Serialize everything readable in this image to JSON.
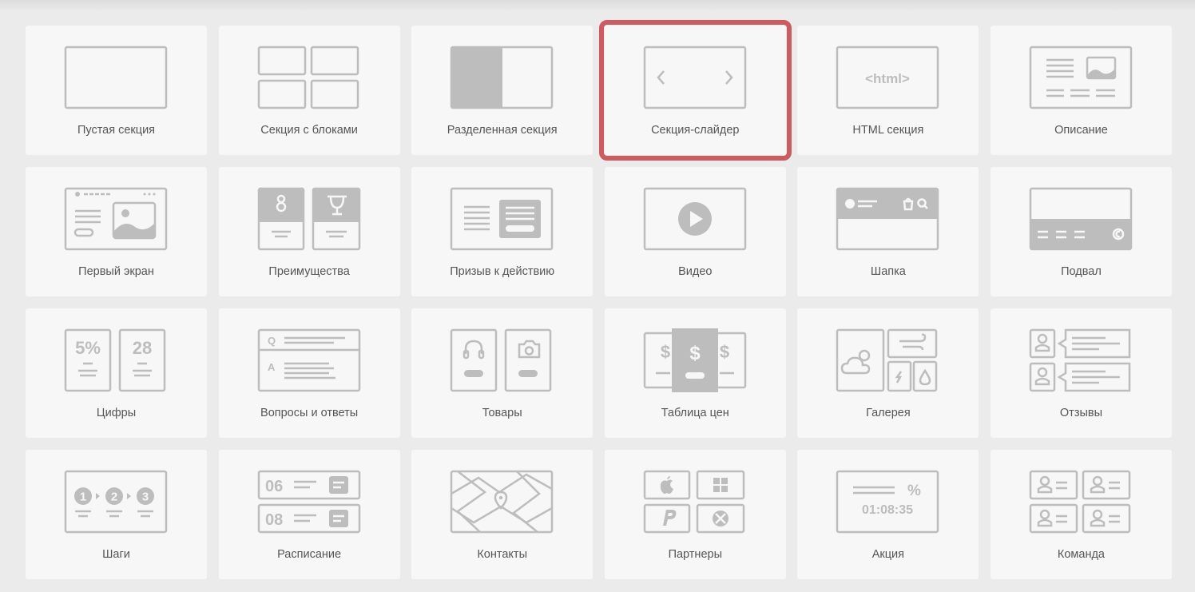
{
  "sections": [
    {
      "label": "Пустая секция",
      "icon": "empty-section-icon",
      "selected": false
    },
    {
      "label": "Секция с блоками",
      "icon": "blocks-section-icon",
      "selected": false
    },
    {
      "label": "Разделенная секция",
      "icon": "split-section-icon",
      "selected": false
    },
    {
      "label": "Секция-слайдер",
      "icon": "slider-section-icon",
      "selected": true
    },
    {
      "label": "HTML секция",
      "icon": "html-section-icon",
      "icon_text": "<html>",
      "selected": false
    },
    {
      "label": "Описание",
      "icon": "description-icon",
      "selected": false
    },
    {
      "label": "Первый экран",
      "icon": "first-screen-icon",
      "selected": false
    },
    {
      "label": "Преимущества",
      "icon": "advantages-icon",
      "selected": false
    },
    {
      "label": "Призыв к действию",
      "icon": "call-to-action-icon",
      "selected": false
    },
    {
      "label": "Видео",
      "icon": "video-icon",
      "selected": false
    },
    {
      "label": "Шапка",
      "icon": "header-icon",
      "selected": false
    },
    {
      "label": "Подвал",
      "icon": "footer-icon",
      "selected": false
    },
    {
      "label": "Цифры",
      "icon": "numbers-icon",
      "icon_text": [
        "5%",
        "28"
      ],
      "selected": false
    },
    {
      "label": "Вопросы и ответы",
      "icon": "faq-icon",
      "icon_text": [
        "Q",
        "A"
      ],
      "selected": false
    },
    {
      "label": "Товары",
      "icon": "products-icon",
      "selected": false
    },
    {
      "label": "Таблица цен",
      "icon": "price-table-icon",
      "icon_text": "$",
      "selected": false
    },
    {
      "label": "Галерея",
      "icon": "gallery-icon",
      "selected": false
    },
    {
      "label": "Отзывы",
      "icon": "reviews-icon",
      "selected": false
    },
    {
      "label": "Шаги",
      "icon": "steps-icon",
      "icon_text": [
        "1",
        "2",
        "3"
      ],
      "selected": false
    },
    {
      "label": "Расписание",
      "icon": "schedule-icon",
      "icon_text": [
        "06",
        "08"
      ],
      "selected": false
    },
    {
      "label": "Контакты",
      "icon": "contacts-map-icon",
      "selected": false
    },
    {
      "label": "Партнеры",
      "icon": "partners-icon",
      "selected": false
    },
    {
      "label": "Акция",
      "icon": "promo-icon",
      "icon_text": [
        "%",
        "01:08:35"
      ],
      "selected": false
    },
    {
      "label": "Команда",
      "icon": "team-icon",
      "selected": false
    }
  ],
  "colors": {
    "background": "#ebebeb",
    "card": "#f7f7f7",
    "icon": "#bdbdbd",
    "label": "#555555",
    "selection": "#cd5c61"
  }
}
